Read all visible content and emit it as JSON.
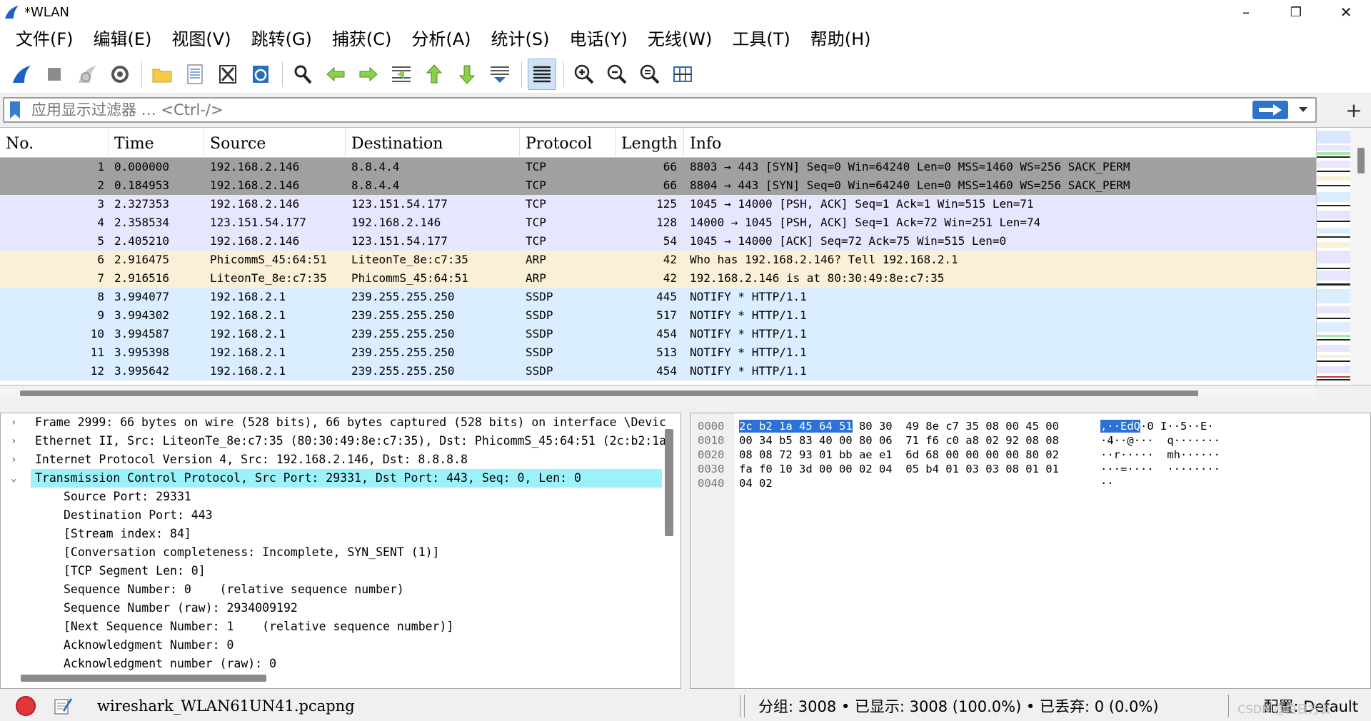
{
  "window": {
    "title": "*WLAN",
    "minimize_glyph": "–",
    "maximize_glyph": "❐",
    "close_glyph": "✕"
  },
  "menu": [
    "文件(F)",
    "编辑(E)",
    "视图(V)",
    "跳转(G)",
    "捕获(C)",
    "分析(A)",
    "统计(S)",
    "电话(Y)",
    "无线(W)",
    "工具(T)",
    "帮助(H)"
  ],
  "toolbar": {
    "icons": [
      "shark-fin-start-icon",
      "stop-capture-icon",
      "restart-capture-icon",
      "capture-options-icon",
      "open-file-icon",
      "save-file-icon",
      "close-file-icon",
      "reload-file-icon",
      "find-packet-icon",
      "go-back-icon",
      "go-forward-icon",
      "go-to-packet-icon",
      "first-packet-icon",
      "last-packet-icon",
      "auto-scroll-icon",
      "colorize-icon",
      "zoom-in-icon",
      "zoom-out-icon",
      "normal-size-icon",
      "resize-columns-icon"
    ]
  },
  "filter": {
    "placeholder": "应用显示过滤器 … <Ctrl-/>",
    "add_label": "+"
  },
  "packet_list": {
    "columns": [
      "No.",
      "Time",
      "Source",
      "Destination",
      "Protocol",
      "Length",
      "Info"
    ],
    "rows": [
      {
        "no": "1",
        "time": "0.000000",
        "src": "192.168.2.146",
        "dst": "8.8.4.4",
        "proto": "TCP",
        "len": "66",
        "info": "8803 → 443 [SYN] Seq=0 Win=64240 Len=0 MSS=1460 WS=256 SACK_PERM",
        "bg": "#a0a0a0"
      },
      {
        "no": "2",
        "time": "0.184953",
        "src": "192.168.2.146",
        "dst": "8.8.4.4",
        "proto": "TCP",
        "len": "66",
        "info": "8804 → 443 [SYN] Seq=0 Win=64240 Len=0 MSS=1460 WS=256 SACK_PERM",
        "bg": "#a0a0a0"
      },
      {
        "no": "3",
        "time": "2.327353",
        "src": "192.168.2.146",
        "dst": "123.151.54.177",
        "proto": "TCP",
        "len": "125",
        "info": "1045 → 14000 [PSH, ACK] Seq=1 Ack=1 Win=515 Len=71",
        "bg": "#e7e6ff"
      },
      {
        "no": "4",
        "time": "2.358534",
        "src": "123.151.54.177",
        "dst": "192.168.2.146",
        "proto": "TCP",
        "len": "128",
        "info": "14000 → 1045 [PSH, ACK] Seq=1 Ack=72 Win=251 Len=74",
        "bg": "#e7e6ff"
      },
      {
        "no": "5",
        "time": "2.405210",
        "src": "192.168.2.146",
        "dst": "123.151.54.177",
        "proto": "TCP",
        "len": "54",
        "info": "1045 → 14000 [ACK] Seq=72 Ack=75 Win=515 Len=0",
        "bg": "#e7e6ff"
      },
      {
        "no": "6",
        "time": "2.916475",
        "src": "PhicommS_45:64:51",
        "dst": "LiteonTe_8e:c7:35",
        "proto": "ARP",
        "len": "42",
        "info": "Who has 192.168.2.146? Tell 192.168.2.1",
        "bg": "#faf0d7"
      },
      {
        "no": "7",
        "time": "2.916516",
        "src": "LiteonTe_8e:c7:35",
        "dst": "PhicommS_45:64:51",
        "proto": "ARP",
        "len": "42",
        "info": "192.168.2.146 is at 80:30:49:8e:c7:35",
        "bg": "#faf0d7"
      },
      {
        "no": "8",
        "time": "3.994077",
        "src": "192.168.2.1",
        "dst": "239.255.255.250",
        "proto": "SSDP",
        "len": "445",
        "info": "NOTIFY * HTTP/1.1",
        "bg": "#daeeff"
      },
      {
        "no": "9",
        "time": "3.994302",
        "src": "192.168.2.1",
        "dst": "239.255.255.250",
        "proto": "SSDP",
        "len": "517",
        "info": "NOTIFY * HTTP/1.1",
        "bg": "#daeeff"
      },
      {
        "no": "10",
        "time": "3.994587",
        "src": "192.168.2.1",
        "dst": "239.255.255.250",
        "proto": "SSDP",
        "len": "454",
        "info": "NOTIFY * HTTP/1.1",
        "bg": "#daeeff"
      },
      {
        "no": "11",
        "time": "3.995398",
        "src": "192.168.2.1",
        "dst": "239.255.255.250",
        "proto": "SSDP",
        "len": "513",
        "info": "NOTIFY * HTTP/1.1",
        "bg": "#daeeff"
      },
      {
        "no": "12",
        "time": "3.995642",
        "src": "192.168.2.1",
        "dst": "239.255.255.250",
        "proto": "SSDP",
        "len": "454",
        "info": "NOTIFY * HTTP/1.1",
        "bg": "#daeeff"
      }
    ]
  },
  "details": {
    "rows": [
      {
        "text": "Frame 2999: 66 bytes on wire (528 bits), 66 bytes captured (528 bits) on interface \\Devic",
        "expander": "›",
        "child": false,
        "selected": false
      },
      {
        "text": "Ethernet II, Src: LiteonTe_8e:c7:35 (80:30:49:8e:c7:35), Dst: PhicommS_45:64:51 (2c:b2:1a",
        "expander": "›",
        "child": false,
        "selected": false
      },
      {
        "text": "Internet Protocol Version 4, Src: 192.168.2.146, Dst: 8.8.8.8",
        "expander": "›",
        "child": false,
        "selected": false
      },
      {
        "text": "Transmission Control Protocol, Src Port: 29331, Dst Port: 443, Seq: 0, Len: 0",
        "expander": "⌄",
        "child": false,
        "selected": true
      },
      {
        "text": "Source Port: 29331",
        "expander": "",
        "child": true,
        "selected": false
      },
      {
        "text": "Destination Port: 443",
        "expander": "",
        "child": true,
        "selected": false
      },
      {
        "text": "[Stream index: 84]",
        "expander": "",
        "child": true,
        "selected": false
      },
      {
        "text": "[Conversation completeness: Incomplete, SYN_SENT (1)]",
        "expander": "",
        "child": true,
        "selected": false
      },
      {
        "text": "[TCP Segment Len: 0]",
        "expander": "",
        "child": true,
        "selected": false
      },
      {
        "text": "Sequence Number: 0    (relative sequence number)",
        "expander": "",
        "child": true,
        "selected": false
      },
      {
        "text": "Sequence Number (raw): 2934009192",
        "expander": "",
        "child": true,
        "selected": false
      },
      {
        "text": "[Next Sequence Number: 1    (relative sequence number)]",
        "expander": "",
        "child": true,
        "selected": false
      },
      {
        "text": "Acknowledgment Number: 0",
        "expander": "",
        "child": true,
        "selected": false
      },
      {
        "text": "Acknowledgment number (raw): 0",
        "expander": "",
        "child": true,
        "selected": false
      }
    ]
  },
  "hex": {
    "rows": [
      {
        "offset": "0000",
        "hl_bytes": "2c b2 1a 45 64 51",
        "bytes": " 80 30  49 8e c7 35 08 00 45 00",
        "hl_ascii": ",··EdQ",
        "ascii": "·0 I··5··E·"
      },
      {
        "offset": "0010",
        "hl_bytes": "",
        "bytes": "00 34 b5 83 40 00 80 06  71 f6 c0 a8 02 92 08 08",
        "hl_ascii": "",
        "ascii": "·4··@···  q·······"
      },
      {
        "offset": "0020",
        "hl_bytes": "",
        "bytes": "08 08 72 93 01 bb ae e1  6d 68 00 00 00 00 80 02",
        "hl_ascii": "",
        "ascii": "··r·····  mh······"
      },
      {
        "offset": "0030",
        "hl_bytes": "",
        "bytes": "fa f0 10 3d 00 00 02 04  05 b4 01 03 03 08 01 01",
        "hl_ascii": "",
        "ascii": "···=····  ········"
      },
      {
        "offset": "0040",
        "hl_bytes": "",
        "bytes": "04 02",
        "hl_ascii": "",
        "ascii": "··"
      }
    ]
  },
  "status": {
    "file": "wireshark_WLAN61UN41.pcapng",
    "stats": "分组: 3008  •  已显示: 3008 (100.0%)  •  已丢弃: 0 (0.0%)",
    "profile": "配置: Default",
    "watermark": "CSDN @白日方云"
  },
  "colors": {
    "tcp_syn_row": "#a0a0a0",
    "tcp_row": "#e7e6ff",
    "arp_row": "#faf0d7",
    "udp_row": "#daeeff",
    "selected_detail": "#9cf2fb",
    "hex_highlight": "#2a72d6",
    "apply_button": "#2e73c8"
  }
}
